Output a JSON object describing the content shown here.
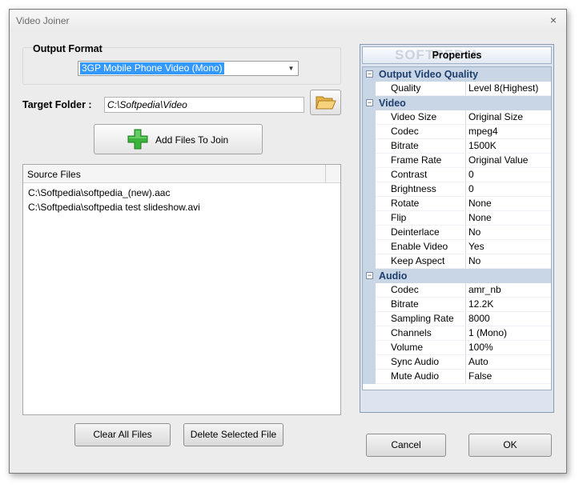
{
  "window": {
    "title": "Video Joiner",
    "close_symbol": "×"
  },
  "output_format": {
    "label": "Output Format",
    "selected": "3GP Mobile Phone Video (Mono)"
  },
  "target_folder": {
    "label": "Target Folder :",
    "value": "C:\\Softpedia\\Video"
  },
  "add_files": {
    "label": "Add Files To Join"
  },
  "source_files": {
    "header": "Source Files",
    "items": [
      "C:\\Softpedia\\softpedia_(new).aac",
      "C:\\Softpedia\\softpedia test slideshow.avi"
    ]
  },
  "buttons": {
    "clear_all": "Clear All Files",
    "delete_selected": "Delete Selected File",
    "cancel": "Cancel",
    "ok": "OK"
  },
  "properties": {
    "title": "Properties",
    "watermark": "SOFTPEDIA",
    "categories": [
      {
        "name": "Output Video Quality",
        "rows": [
          {
            "name": "Quality",
            "value": "Level 8(Highest)"
          }
        ]
      },
      {
        "name": "Video",
        "rows": [
          {
            "name": "Video Size",
            "value": "Original Size"
          },
          {
            "name": "Codec",
            "value": "mpeg4"
          },
          {
            "name": "Bitrate",
            "value": "1500K"
          },
          {
            "name": "Frame Rate",
            "value": "Original Value"
          },
          {
            "name": "Contrast",
            "value": "0"
          },
          {
            "name": "Brightness",
            "value": "0"
          },
          {
            "name": "Rotate",
            "value": "None"
          },
          {
            "name": "Flip",
            "value": "None"
          },
          {
            "name": "Deinterlace",
            "value": "No"
          },
          {
            "name": "Enable Video",
            "value": "Yes"
          },
          {
            "name": "Keep Aspect",
            "value": "No"
          }
        ]
      },
      {
        "name": "Audio",
        "rows": [
          {
            "name": "Codec",
            "value": "amr_nb"
          },
          {
            "name": "Bitrate",
            "value": "12.2K"
          },
          {
            "name": "Sampling Rate",
            "value": "8000"
          },
          {
            "name": "Channels",
            "value": "1 (Mono)"
          },
          {
            "name": "Volume",
            "value": "100%"
          },
          {
            "name": "Sync Audio",
            "value": "Auto"
          },
          {
            "name": "Mute Audio",
            "value": "False"
          }
        ]
      }
    ]
  },
  "icons": {
    "folder": "open-folder-icon",
    "add": "green-plus-icon",
    "collapse": "minus-toggle-icon",
    "dropdown": "chevron-down-icon"
  },
  "colors": {
    "window_bg": "#ececec",
    "selection": "#3399ff",
    "grid_category": "#c9d6e6",
    "grid_category_text": "#1f3f6e",
    "plus_green": "#3cb43c"
  }
}
